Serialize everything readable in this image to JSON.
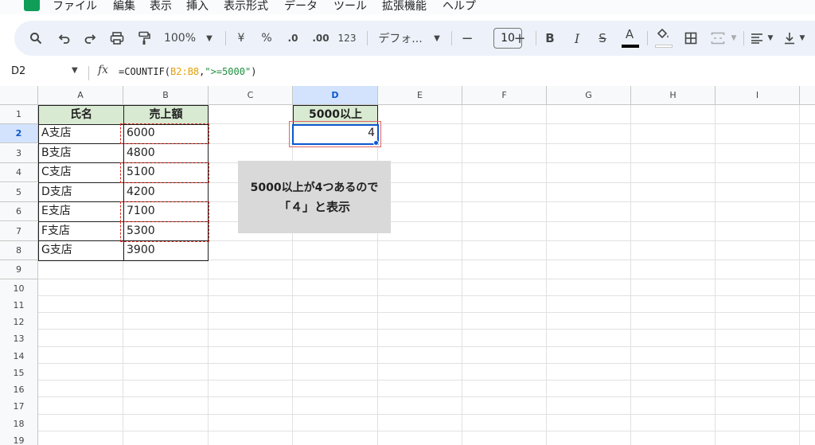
{
  "menu": [
    "ファイル",
    "編集",
    "表示",
    "挿入",
    "表示形式",
    "データ",
    "ツール",
    "拡張機能",
    "ヘルプ"
  ],
  "toolbar": {
    "zoom": "100%",
    "currency": "¥",
    "percent": "%",
    "decrease_decimal": ".0",
    "increase_decimal": ".00",
    "number_format": "123",
    "font": "デフォ...",
    "minus": "−",
    "font_size": "10",
    "plus": "+",
    "bold": "B",
    "italic": "I",
    "strike": "S",
    "text_color": "A"
  },
  "formula_bar": {
    "cell_ref": "D2",
    "fx": "fx",
    "formula_prefix": "=COUNTIF(",
    "formula_range": "B2:B8",
    "formula_comma": ",",
    "formula_criteria": "\">=5000\"",
    "formula_suffix": ")"
  },
  "columns": [
    "A",
    "B",
    "C",
    "D",
    "E",
    "F",
    "G",
    "H",
    "I"
  ],
  "rows": [
    "1",
    "2",
    "3",
    "4",
    "5",
    "6",
    "7",
    "8",
    "9",
    "10",
    "11",
    "12",
    "13",
    "14",
    "15",
    "16",
    "17",
    "18",
    "19"
  ],
  "table": {
    "header_name": "氏名",
    "header_sales": "売上額",
    "rows": [
      {
        "name": "A支店",
        "sales": "6000"
      },
      {
        "name": "B支店",
        "sales": "4800"
      },
      {
        "name": "C支店",
        "sales": "5100"
      },
      {
        "name": "D支店",
        "sales": "4200"
      },
      {
        "name": "E支店",
        "sales": "7100"
      },
      {
        "name": "F支店",
        "sales": "5300"
      },
      {
        "name": "G支店",
        "sales": "3900"
      }
    ]
  },
  "result": {
    "header": "5000以上",
    "value": "4"
  },
  "callout": {
    "line1": "5000以上が4つあるので",
    "line2": "「４」と表示"
  },
  "colors": {
    "header_fill": "#d9ead3",
    "highlight_red": "#d93025",
    "selection_blue": "#0b57d0",
    "callout_fill": "#d9d9d9"
  }
}
